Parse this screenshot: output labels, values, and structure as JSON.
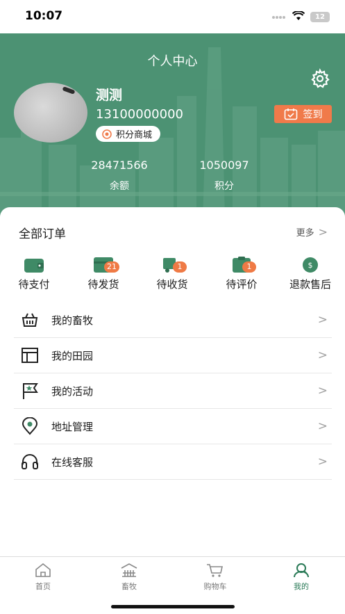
{
  "status_bar": {
    "time": "10:07",
    "battery": "12"
  },
  "header": {
    "title": "个人中心",
    "icons": [
      "gear-icon"
    ]
  },
  "profile": {
    "name": "测测",
    "phone": "13100000000",
    "points_mall_label": "积分商城",
    "signin_label": "签到"
  },
  "stats": {
    "balance": {
      "value": "28471566",
      "label": "余额"
    },
    "points": {
      "value": "1050097",
      "label": "积分"
    }
  },
  "orders": {
    "title": "全部订单",
    "more_label": "更多",
    "more_arrow": ">",
    "items": [
      {
        "label": "待支付",
        "icon": "wallet-icon",
        "badge": ""
      },
      {
        "label": "待发货",
        "icon": "package-icon",
        "badge": "21"
      },
      {
        "label": "待收货",
        "icon": "truck-icon",
        "badge": "1"
      },
      {
        "label": "待评价",
        "icon": "review-icon",
        "badge": "1"
      },
      {
        "label": "退款售后",
        "icon": "refund-icon",
        "badge": ""
      }
    ]
  },
  "menu": [
    {
      "label": "我的畜牧",
      "icon": "basket-icon",
      "arrow": ">"
    },
    {
      "label": "我的田园",
      "icon": "layout-icon",
      "arrow": ">"
    },
    {
      "label": "我的活动",
      "icon": "flag-icon",
      "arrow": ">"
    },
    {
      "label": "地址管理",
      "icon": "location-icon",
      "arrow": ">"
    },
    {
      "label": "在线客服",
      "icon": "headset-icon",
      "arrow": ">"
    }
  ],
  "tabs": [
    {
      "label": "首页",
      "icon": "home-icon",
      "active": false
    },
    {
      "label": "畜牧",
      "icon": "barn-icon",
      "active": false
    },
    {
      "label": "购物车",
      "icon": "cart-icon",
      "active": false
    },
    {
      "label": "我的",
      "icon": "user-icon",
      "active": true
    }
  ],
  "colors": {
    "primary_green": "#4c9273",
    "accent_orange": "#f07a4a",
    "active_tab": "#2a7a57"
  }
}
